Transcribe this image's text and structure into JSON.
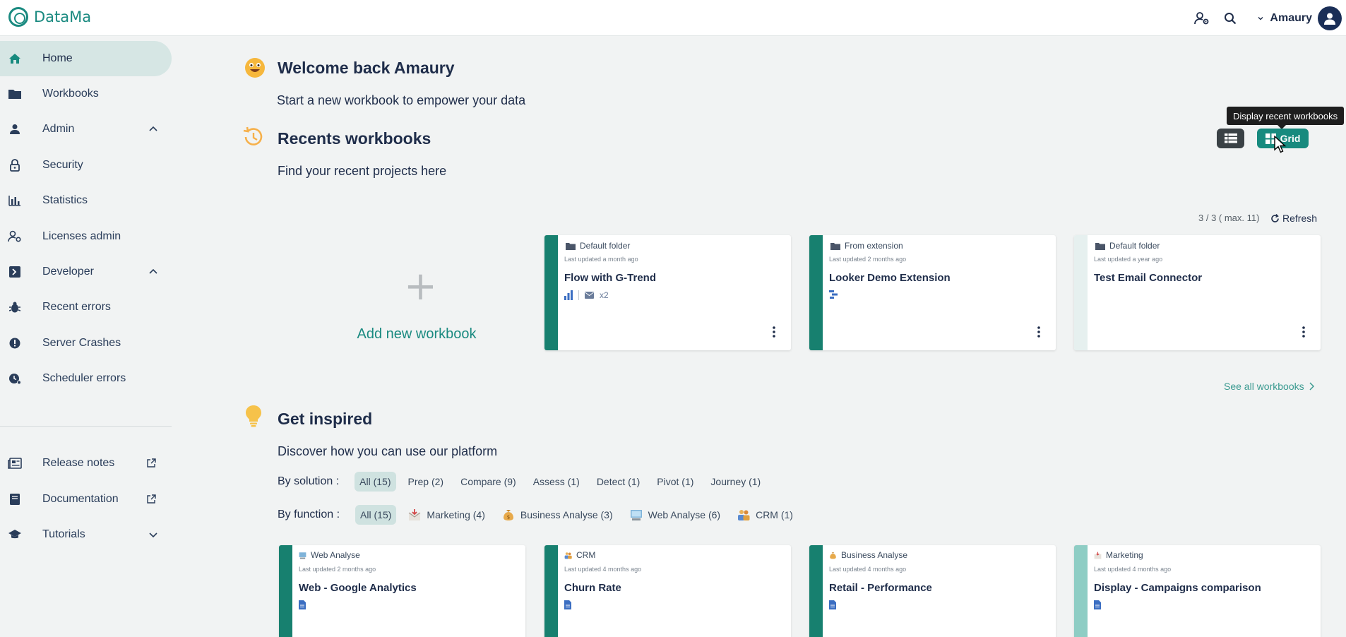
{
  "app": {
    "name": "DataMa"
  },
  "header": {
    "user_name": "Amaury"
  },
  "sidebar": {
    "items": [
      {
        "label": "Home"
      },
      {
        "label": "Workbooks"
      },
      {
        "label": "Admin"
      },
      {
        "label": "Security"
      },
      {
        "label": "Statistics"
      },
      {
        "label": "Licenses admin"
      },
      {
        "label": "Developer"
      },
      {
        "label": "Recent errors"
      },
      {
        "label": "Server Crashes"
      },
      {
        "label": "Scheduler errors"
      },
      {
        "label": "Release notes"
      },
      {
        "label": "Documentation"
      },
      {
        "label": "Tutorials"
      }
    ]
  },
  "welcome": {
    "title": "Welcome back Amaury",
    "subtitle": "Start a new workbook to empower your data"
  },
  "recents": {
    "title": "Recents workbooks",
    "subtitle": "Find your recent projects here",
    "view_grid_label": "Grid",
    "tooltip": "Display recent workbooks",
    "count": "3 / 3 ( max. 11)",
    "refresh_label": "Refresh",
    "add_label": "Add new workbook",
    "see_all": "See all workbooks",
    "cards": [
      {
        "folder": "Default folder",
        "updated": "Last updated a month ago",
        "title": "Flow with G-Trend",
        "meta": "x2"
      },
      {
        "folder": "From extension",
        "updated": "Last updated 2 months ago",
        "title": "Looker Demo Extension",
        "meta": ""
      },
      {
        "folder": "Default folder",
        "updated": "Last updated a year ago",
        "title": "Test Email Connector",
        "meta": ""
      }
    ]
  },
  "inspired": {
    "title": "Get inspired",
    "subtitle": "Discover how you can use our platform",
    "by_solution_label": "By solution :",
    "solutions": [
      "All (15)",
      "Prep (2)",
      "Compare (9)",
      "Assess (1)",
      "Detect (1)",
      "Pivot (1)",
      "Journey (1)"
    ],
    "by_function_label": "By function :",
    "functions": [
      "All (15)",
      "Marketing (4)",
      "Business Analyse (3)",
      "Web Analyse (6)",
      "CRM (1)"
    ],
    "cards": [
      {
        "category": "Web Analyse",
        "updated": "Last updated 2 months ago",
        "title": "Web - Google Analytics"
      },
      {
        "category": "CRM",
        "updated": "Last updated 4 months ago",
        "title": "Churn Rate"
      },
      {
        "category": "Business Analyse",
        "updated": "Last updated 4 months ago",
        "title": "Retail - Performance"
      },
      {
        "category": "Marketing",
        "updated": "Last updated 4 months ago",
        "title": "Display - Campaigns comparison"
      }
    ]
  },
  "colors": {
    "brand": "#1a8a80",
    "sidebar_active": "#d6e6e4",
    "card_bar": "#17806f",
    "navy": "#1f2d4a"
  }
}
